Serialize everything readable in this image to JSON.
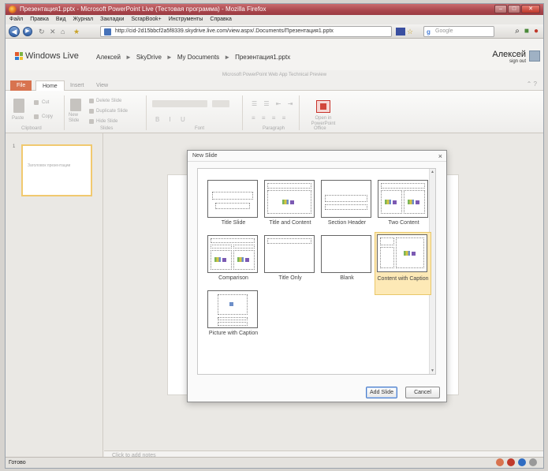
{
  "browser": {
    "title": "Презентация1.pptx - Microsoft PowerPoint Live (Тестовая программа) - Mozilla Firefox",
    "menu": [
      "Файл",
      "Правка",
      "Вид",
      "Журнал",
      "Закладки",
      "ScrapBook+",
      "Инструменты",
      "Справка"
    ],
    "url": "http://cid-2d15bbcf2a5f8339.skydrive.live.com/view.aspx/.Documents/Презентация1.pptx",
    "search_placeholder": "Google",
    "status": "Готово",
    "win_buttons": [
      "–",
      "□",
      "✕"
    ]
  },
  "live": {
    "logo": "Windows Live",
    "breadcrumb": [
      "Алексей",
      "SkyDrive",
      "My Documents",
      "Презентация1.pptx"
    ],
    "user_name": "Алексей",
    "sign_out": "sign out"
  },
  "app": {
    "title": "Microsoft PowerPoint Web App Technical Preview",
    "tabs": [
      "File",
      "Home",
      "Insert",
      "View"
    ],
    "ribbon": {
      "paste": "Paste",
      "cut": "Cut",
      "copy": "Copy",
      "new_slide": "New Slide",
      "delete_slide": "Delete Slide",
      "duplicate_slide": "Duplicate Slide",
      "hide_slide": "Hide Slide",
      "open_in_powerpoint": "Open in PowerPoint",
      "groups": [
        "Clipboard",
        "Slides",
        "Font",
        "Paragraph",
        "Office"
      ]
    },
    "thumbnail": {
      "number": "1",
      "text": "Заголовок презентации"
    },
    "notes_placeholder": "Click to add notes"
  },
  "dialog": {
    "title": "New Slide",
    "layouts": [
      {
        "label": "Title Slide",
        "selected": false
      },
      {
        "label": "Title and Content",
        "selected": false
      },
      {
        "label": "Section Header",
        "selected": false
      },
      {
        "label": "Two Content",
        "selected": false
      },
      {
        "label": "Comparison",
        "selected": false
      },
      {
        "label": "Title Only",
        "selected": false
      },
      {
        "label": "Blank",
        "selected": false
      },
      {
        "label": "Content with Caption",
        "selected": true
      },
      {
        "label": "Picture with Caption",
        "selected": false
      }
    ],
    "add_button": "Add Slide",
    "cancel_button": "Cancel"
  },
  "colors": {
    "accent": "#d8734f",
    "selection": "#fde9b6",
    "firefox_titlebar": "#a9464c"
  }
}
